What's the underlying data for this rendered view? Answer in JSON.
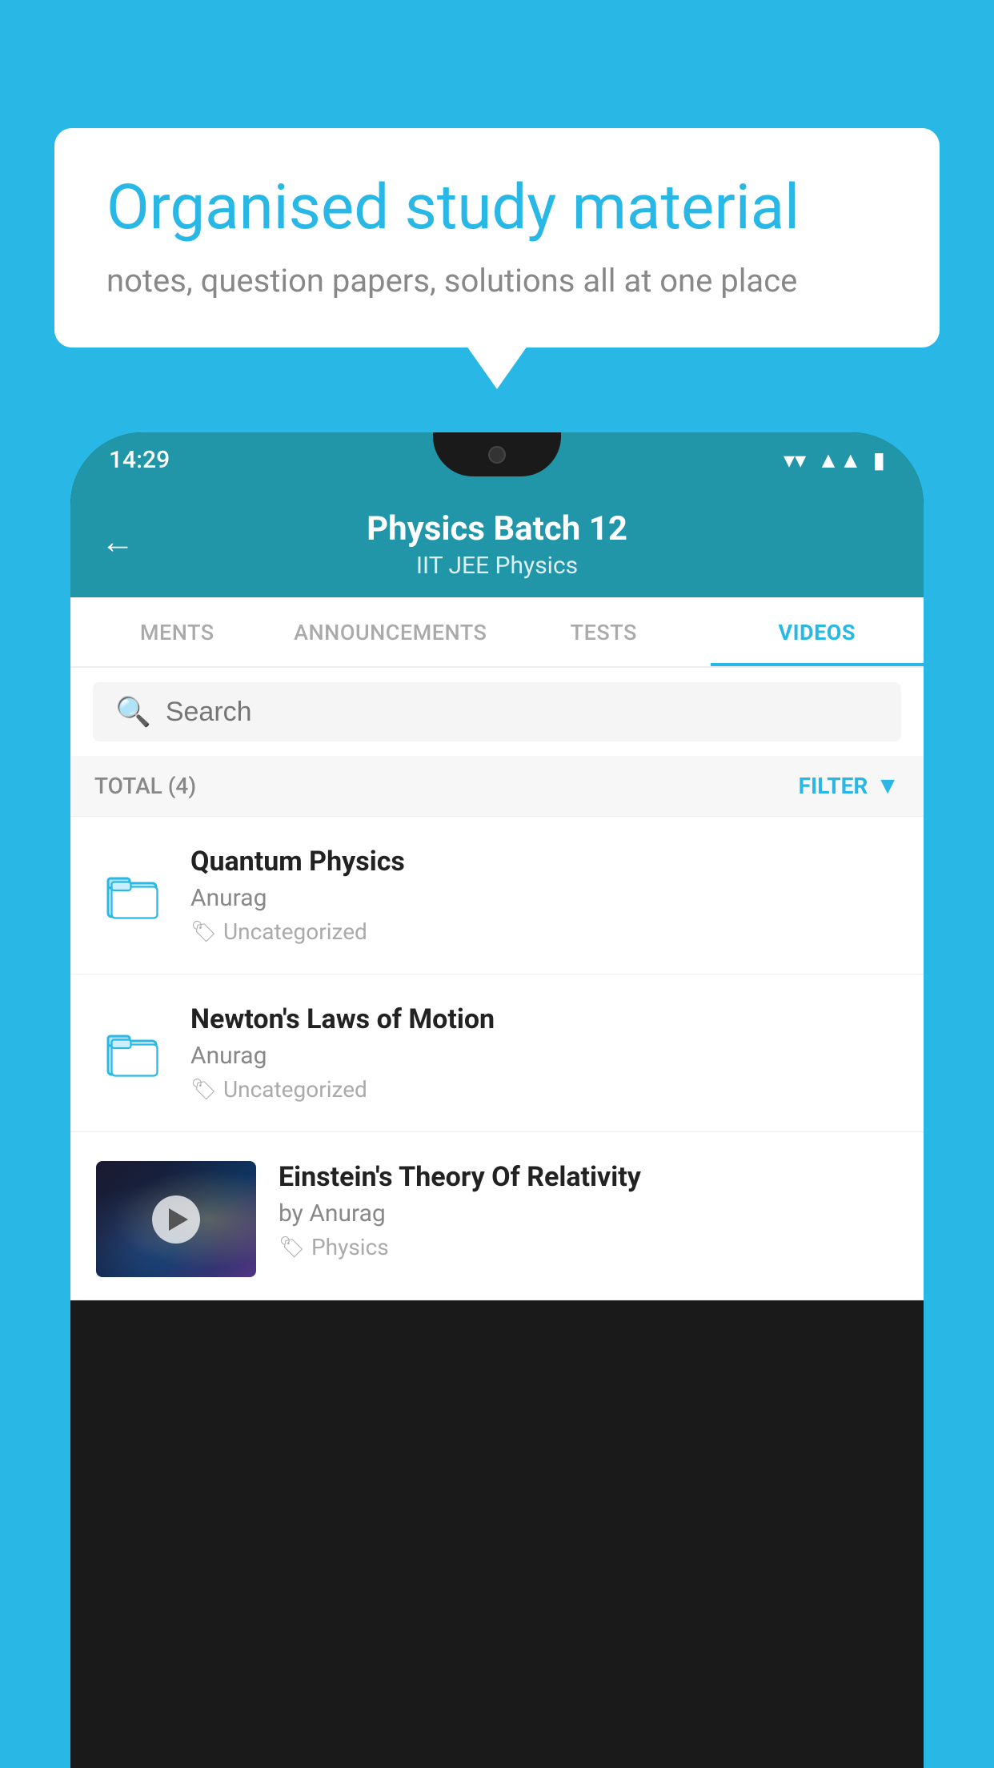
{
  "background_color": "#29b8e5",
  "speech_bubble": {
    "title": "Organised study material",
    "subtitle": "notes, question papers, solutions all at one place"
  },
  "phone": {
    "status_bar": {
      "time": "14:29",
      "icons": [
        "wifi",
        "signal",
        "battery"
      ]
    },
    "header": {
      "back_label": "←",
      "title": "Physics Batch 12",
      "subtitle": "IIT JEE   Physics"
    },
    "tabs": [
      {
        "label": "MENTS",
        "active": false
      },
      {
        "label": "ANNOUNCEMENTS",
        "active": false
      },
      {
        "label": "TESTS",
        "active": false
      },
      {
        "label": "VIDEOS",
        "active": true
      }
    ],
    "search": {
      "placeholder": "Search"
    },
    "filter_bar": {
      "total_label": "TOTAL (4)",
      "filter_label": "FILTER"
    },
    "videos": [
      {
        "title": "Quantum Physics",
        "author": "Anurag",
        "tag": "Uncategorized",
        "type": "folder"
      },
      {
        "title": "Newton's Laws of Motion",
        "author": "Anurag",
        "tag": "Uncategorized",
        "type": "folder"
      },
      {
        "title": "Einstein's Theory Of Relativity",
        "author": "by Anurag",
        "tag": "Physics",
        "type": "video"
      }
    ]
  }
}
